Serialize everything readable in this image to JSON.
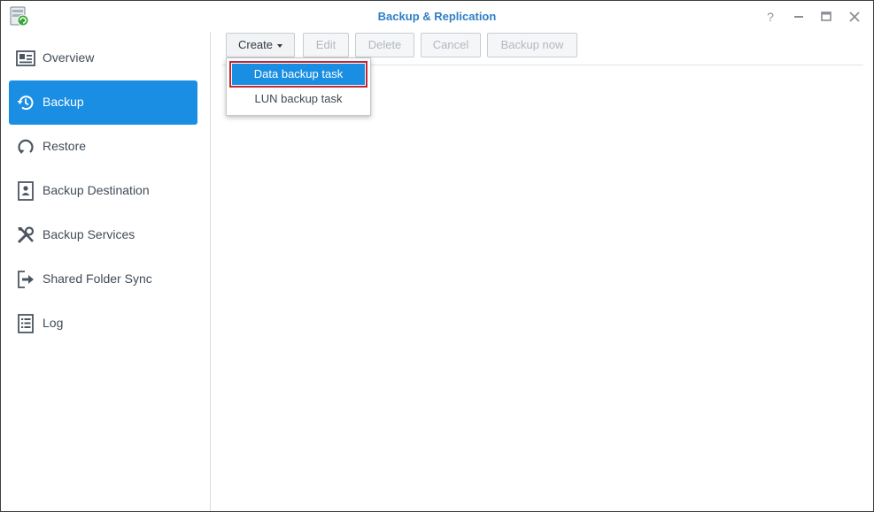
{
  "window": {
    "title": "Backup & Replication",
    "controls": [
      "help-icon",
      "minimize-icon",
      "restore-icon",
      "close-icon"
    ]
  },
  "sidebar": {
    "items": [
      {
        "label": "Overview",
        "icon": "overview-icon",
        "active": false
      },
      {
        "label": "Backup",
        "icon": "backup-icon",
        "active": true
      },
      {
        "label": "Restore",
        "icon": "restore-icon",
        "active": false
      },
      {
        "label": "Backup Destination",
        "icon": "backup-destination-icon",
        "active": false
      },
      {
        "label": "Backup Services",
        "icon": "tools-icon",
        "active": false
      },
      {
        "label": "Shared Folder Sync",
        "icon": "folder-sync-icon",
        "active": false
      },
      {
        "label": "Log",
        "icon": "log-icon",
        "active": false
      }
    ]
  },
  "toolbar": {
    "create_label": "Create",
    "edit_label": "Edit",
    "delete_label": "Delete",
    "cancel_label": "Cancel",
    "backup_now_label": "Backup now"
  },
  "create_menu": {
    "items": [
      {
        "label": "Data backup task",
        "selected": true
      },
      {
        "label": "LUN backup task",
        "selected": false
      }
    ]
  },
  "colors": {
    "accent": "#1a8ee3",
    "title": "#2e7fc6",
    "highlight_border": "#c1272d",
    "text": "#404b56"
  }
}
